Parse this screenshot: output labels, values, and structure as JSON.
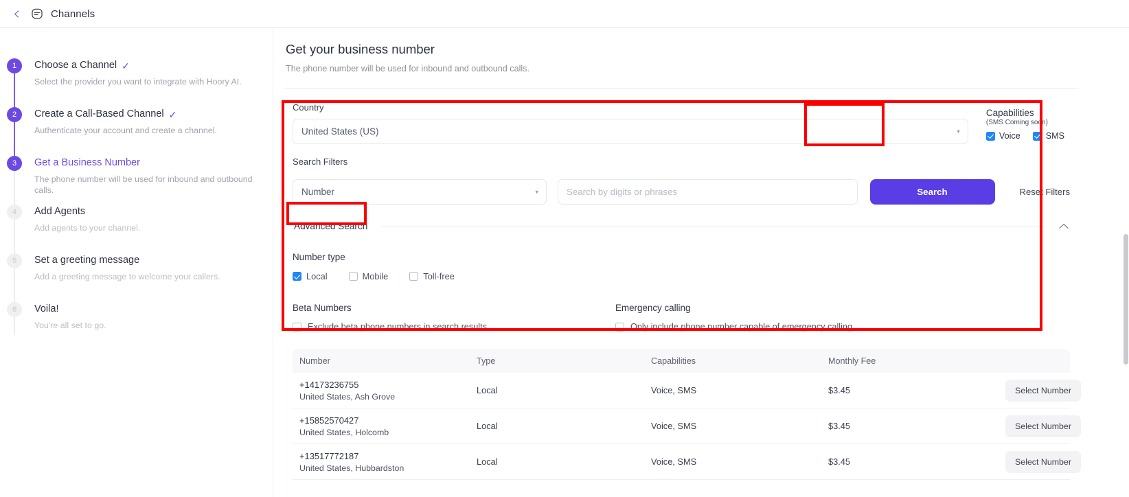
{
  "topbar": {
    "back_icon": "chevron-left-icon",
    "brand_icon": "channels-icon",
    "title": "Channels"
  },
  "sidebar": {
    "steps": [
      {
        "num": "1",
        "title": "Choose a Channel",
        "desc": "Select the provider you want to integrate with Hoory AI.",
        "state": "done",
        "check": "✓"
      },
      {
        "num": "2",
        "title": "Create a Call-Based Channel",
        "desc": "Authenticate your account and create a channel.",
        "state": "done",
        "check": "✓"
      },
      {
        "num": "3",
        "title": "Get a Business Number",
        "desc": "The phone number will be used for inbound and outbound calls.",
        "state": "current",
        "check": ""
      },
      {
        "num": "4",
        "title": "Add Agents",
        "desc": "Add agents to your channel.",
        "state": "todo",
        "check": ""
      },
      {
        "num": "5",
        "title": "Set a greeting message",
        "desc": "Add a greeting message to welcome your callers.",
        "state": "todo",
        "check": ""
      },
      {
        "num": "6",
        "title": "Voila!",
        "desc": "You're all set to go.",
        "state": "todo",
        "check": ""
      }
    ]
  },
  "main": {
    "title": "Get your business number",
    "subtitle": "The phone number will be used for inbound and outbound calls."
  },
  "filters": {
    "country_label": "Country",
    "country_value": "United States (US)",
    "country_caret": "▾",
    "capabilities": {
      "title": "Capabilities",
      "subtitle": "(SMS Coming soon)",
      "items": [
        {
          "label": "Voice",
          "checked": true
        },
        {
          "label": "SMS",
          "checked": true
        }
      ]
    },
    "search_filters_label": "Search Filters",
    "filter_type_value": "Number",
    "filter_type_caret": "▾",
    "search_placeholder": "Search by digits or phrases",
    "search_value": "",
    "search_button": "Search",
    "reset_button": "Reset Filters"
  },
  "advanced": {
    "header": "Advanced Search",
    "collapse_icon": "chevron-up-icon",
    "number_type_label": "Number type",
    "number_types": [
      {
        "label": "Local",
        "checked": true
      },
      {
        "label": "Mobile",
        "checked": false
      },
      {
        "label": "Toll-free",
        "checked": false
      }
    ],
    "beta_label": "Beta Numbers",
    "beta_option": {
      "label": "Exclude beta phone numbers in search results.",
      "checked": false
    },
    "emergency_label": "Emergency calling",
    "emergency_option": {
      "label": "Only include phone number capable of emergency calling",
      "checked": false
    }
  },
  "results": {
    "columns": [
      "Number",
      "Type",
      "Capabilities",
      "Monthly Fee",
      ""
    ],
    "rows": [
      {
        "number": "+14173236755",
        "location": "United States, Ash Grove",
        "type": "Local",
        "capabilities": "Voice, SMS",
        "fee": "$3.45",
        "action": "Select Number"
      },
      {
        "number": "+15852570427",
        "location": "United States, Holcomb",
        "type": "Local",
        "capabilities": "Voice, SMS",
        "fee": "$3.45",
        "action": "Select Number"
      },
      {
        "number": "+13517772187",
        "location": "United States, Hubbardston",
        "type": "Local",
        "capabilities": "Voice, SMS",
        "fee": "$3.45",
        "action": "Select Number"
      }
    ]
  },
  "colors": {
    "brand_purple": "#6c4ae2",
    "search_button": "#5b3de6",
    "checkbox_blue": "#1f86f8",
    "annotation_red": "#fb0000"
  }
}
